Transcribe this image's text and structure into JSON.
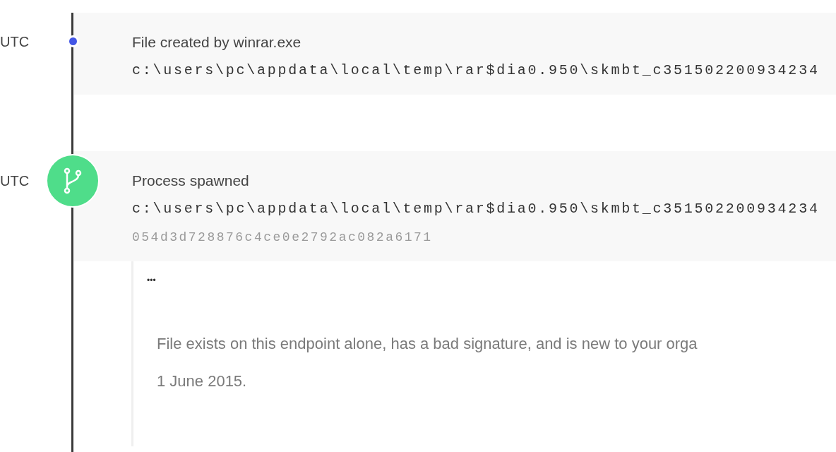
{
  "events": [
    {
      "time": "UTC",
      "kind": "file",
      "title": "File created by winrar.exe",
      "path": "c:\\users\\pc\\appdata\\local\\temp\\rar$dia0.950\\skmbt_c351502200934234"
    },
    {
      "time": "UTC",
      "kind": "process",
      "title": "Process spawned",
      "path": "c:\\users\\pc\\appdata\\local\\temp\\rar$dia0.950\\skmbt_c351502200934234",
      "hash": "054d3d728876c4ce0e2792ac082a6171"
    }
  ],
  "detail": {
    "menu": "•••",
    "lines": [
      "File exists on this endpoint alone, has a bad signature, and is new to your orga",
      "1 June 2015."
    ]
  }
}
